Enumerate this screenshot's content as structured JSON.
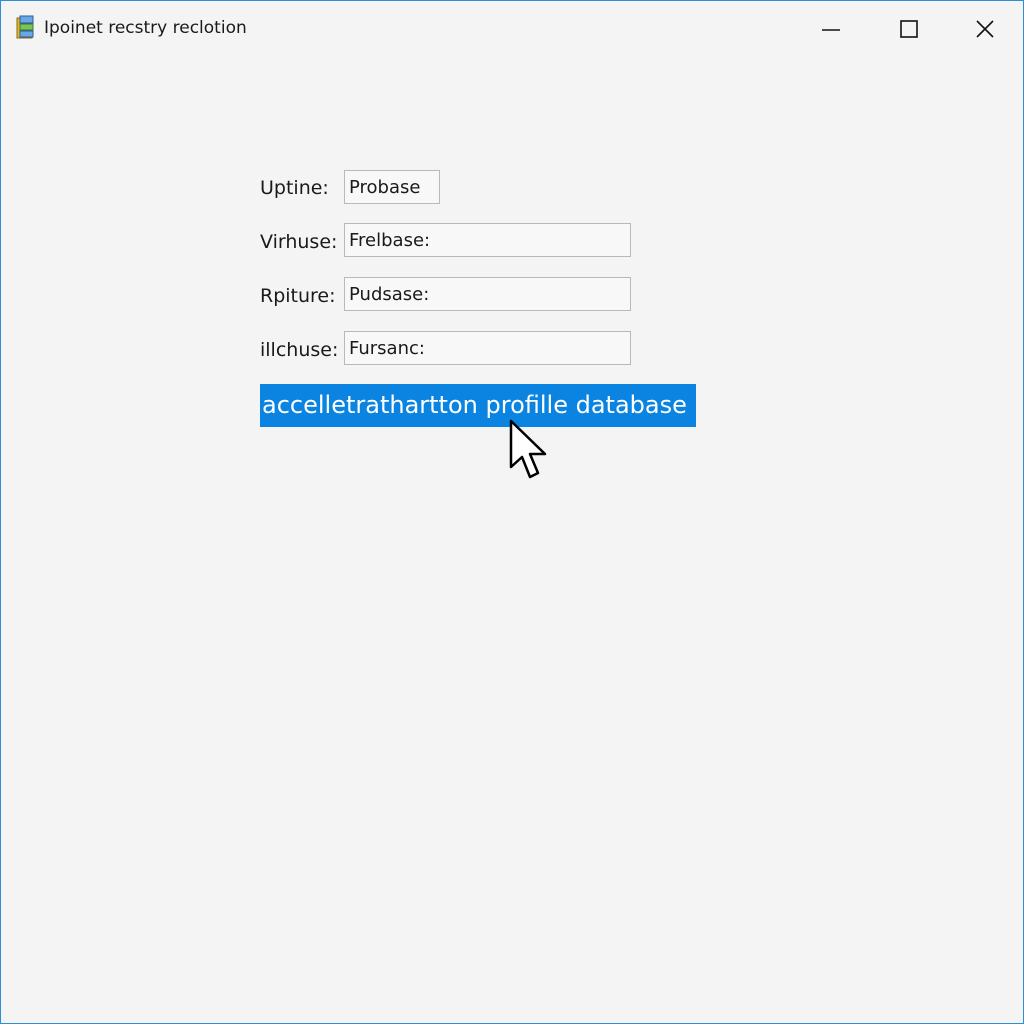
{
  "window": {
    "title": "Ipoinet recstry reclotion",
    "app_icon": "database-icon",
    "controls": {
      "minimize_icon": "minimize-icon",
      "maximize_icon": "maximize-icon",
      "close_icon": "close-icon"
    }
  },
  "form": {
    "rows": [
      {
        "label": "Uptine:",
        "value": "Probase"
      },
      {
        "label": "Virhuse:",
        "value": "Frelbase:"
      },
      {
        "label": "Rpiture:",
        "value": "Pudsase:"
      },
      {
        "label": "illchuse:",
        "value": "Fursanc:"
      }
    ]
  },
  "selection": {
    "text": "accelletrathartton profille database"
  },
  "cursor": {
    "icon": "mouse-pointer-icon"
  },
  "colors": {
    "accent": "#0a84e0",
    "window_border": "#2f8fd4",
    "background": "#f4f4f4"
  }
}
